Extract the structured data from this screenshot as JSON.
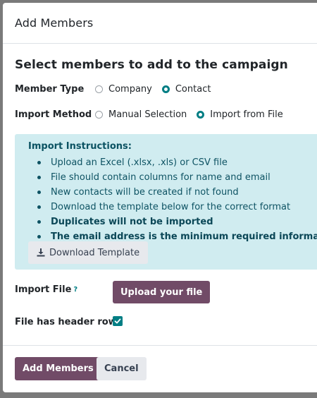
{
  "dialog": {
    "title": "Add Members"
  },
  "body": {
    "section_title": "Select members to add to the campaign",
    "member_type": {
      "label": "Member Type",
      "options": [
        {
          "label": "Company",
          "checked": false
        },
        {
          "label": "Contact",
          "checked": true
        }
      ]
    },
    "import_method": {
      "label": "Import Method",
      "options": [
        {
          "label": "Manual Selection",
          "checked": false
        },
        {
          "label": "Import from File",
          "checked": true
        }
      ]
    },
    "instructions": {
      "title": "Import Instructions:",
      "items": [
        {
          "text": "Upload an Excel (.xlsx, .xls) or CSV file",
          "bold": false
        },
        {
          "text": "File should contain columns for name and email",
          "bold": false
        },
        {
          "text": "New contacts will be created if not found",
          "bold": false
        },
        {
          "text": "Download the template below for the correct format",
          "bold": false
        },
        {
          "text": "Duplicates will not be imported",
          "bold": true
        },
        {
          "text": "The email address is the minimum required information",
          "bold": true
        }
      ],
      "download_label": "Download Template",
      "download_icon": "download-icon"
    },
    "import_file": {
      "label": "Import File",
      "help": "?",
      "button_label": "Upload your file"
    },
    "header_row": {
      "label": "File has header row",
      "checked": true
    }
  },
  "footer": {
    "primary_label": "Add Members",
    "secondary_label": "Cancel"
  },
  "colors": {
    "primary": "#714b67",
    "accent": "#017e84",
    "info_bg": "#d0ecf0"
  }
}
